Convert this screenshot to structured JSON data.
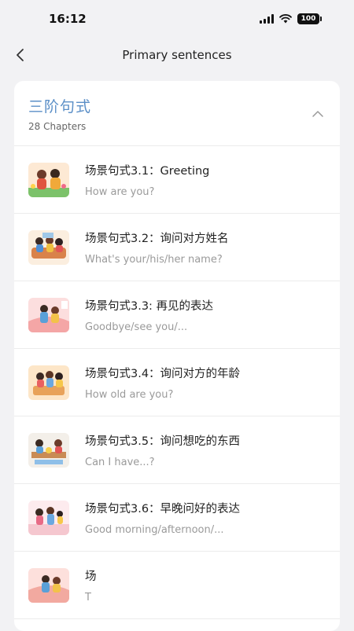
{
  "status": {
    "time": "16:12",
    "battery": "100"
  },
  "nav": {
    "title": "Primary sentences"
  },
  "section": {
    "title": "三阶句式",
    "subtitle": "28 Chapters"
  },
  "items": [
    {
      "title": "场景句式3.1：Greeting",
      "subtitle": "How are you?"
    },
    {
      "title": "场景句式3.2：询问对方姓名",
      "subtitle": "What's your/his/her name?"
    },
    {
      "title": "场景句式3.3: 再见的表达",
      "subtitle": "Goodbye/see you/..."
    },
    {
      "title": "场景句式3.4：询问对方的年龄",
      "subtitle": "How old are you?"
    },
    {
      "title": "场景句式3.5：询问想吃的东西",
      "subtitle": "Can I have...?"
    },
    {
      "title": "场景句式3.6：早晚问好的表达",
      "subtitle": "Good morning/afternoon/..."
    },
    {
      "title": "场",
      "subtitle": "T"
    }
  ],
  "colors": {
    "accent": "#5b8fc7",
    "background": "#f2f2f4"
  }
}
